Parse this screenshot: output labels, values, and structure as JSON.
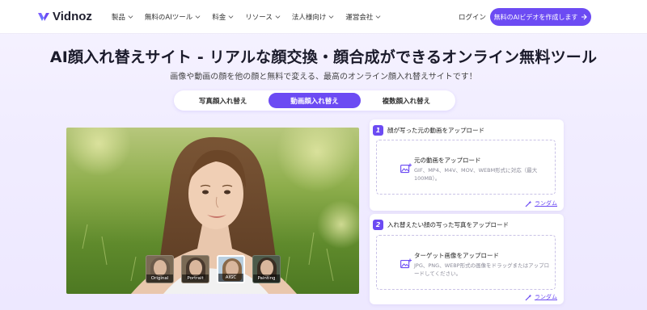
{
  "nav": {
    "logo_text": "Vidnoz",
    "menu": [
      {
        "label": "製品"
      },
      {
        "label": "無料のAIツール"
      },
      {
        "label": "料金"
      },
      {
        "label": "リソース"
      },
      {
        "label": "法人様向け"
      },
      {
        "label": "運営会社"
      }
    ],
    "login": "ログイン",
    "cta": "無料のAIビデオを作成します",
    "cta_icon": "arrow-right-icon",
    "accent": "#6c4bf3"
  },
  "hero": {
    "title": "AI顔入れ替えサイト - リアルな顔交換・顔合成ができるオンライン無料ツール",
    "subtitle": "画像や動画の顔を他の顔と無料で変える、最高のオンライン顔入れ替えサイトです！"
  },
  "tabs": [
    {
      "label": "写真顔入れ替え",
      "active": false
    },
    {
      "label": "動画顔入れ替え",
      "active": true
    },
    {
      "label": "複数顔入れ替え",
      "active": false
    }
  ],
  "thumbs": [
    {
      "label": "Original",
      "active": false
    },
    {
      "label": "Portrait",
      "active": false
    },
    {
      "label": "AIGC",
      "active": true
    },
    {
      "label": "Painting",
      "active": false
    }
  ],
  "steps": [
    {
      "num": "1",
      "text": "顔が写った元の動画をアップロード",
      "drop_title": "元の動画をアップロード",
      "drop_sub": "GIF、MP4、M4V、MOV、WEBM形式に対応（最大100MB）。",
      "random": "ランダム"
    },
    {
      "num": "2",
      "text": "入れ替えたい顔の写った写真をアップロード",
      "drop_title": "ターゲット画像をアップロード",
      "drop_sub": "JPG、PNG、WEBP形式の画像をドラッグまたはアップロードしてください。",
      "random": "ランダム"
    }
  ]
}
